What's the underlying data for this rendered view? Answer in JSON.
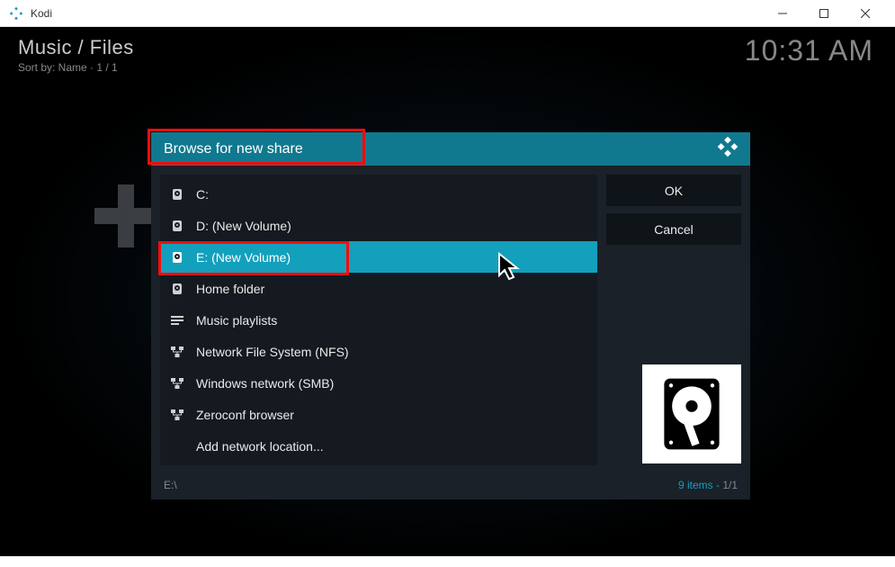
{
  "window": {
    "title": "Kodi"
  },
  "header": {
    "breadcrumb": "Music / Files",
    "sort_line": "Sort by: Name  ·  1 / 1",
    "clock": "10:31 AM"
  },
  "dialog": {
    "title": "Browse for new share",
    "ok_label": "OK",
    "cancel_label": "Cancel",
    "items": [
      {
        "icon": "drive",
        "label": "C:"
      },
      {
        "icon": "drive",
        "label": "D: (New Volume)"
      },
      {
        "icon": "drive",
        "label": "E: (New Volume)",
        "selected": true
      },
      {
        "icon": "drive",
        "label": "Home folder"
      },
      {
        "icon": "list",
        "label": "Music playlists"
      },
      {
        "icon": "net",
        "label": "Network File System (NFS)"
      },
      {
        "icon": "net",
        "label": "Windows network (SMB)"
      },
      {
        "icon": "net",
        "label": "Zeroconf browser"
      },
      {
        "icon": "none",
        "label": "Add network location..."
      }
    ],
    "footer_path": "E:\\",
    "footer_count_prefix": "9 items - ",
    "footer_count_page": "1/1"
  }
}
